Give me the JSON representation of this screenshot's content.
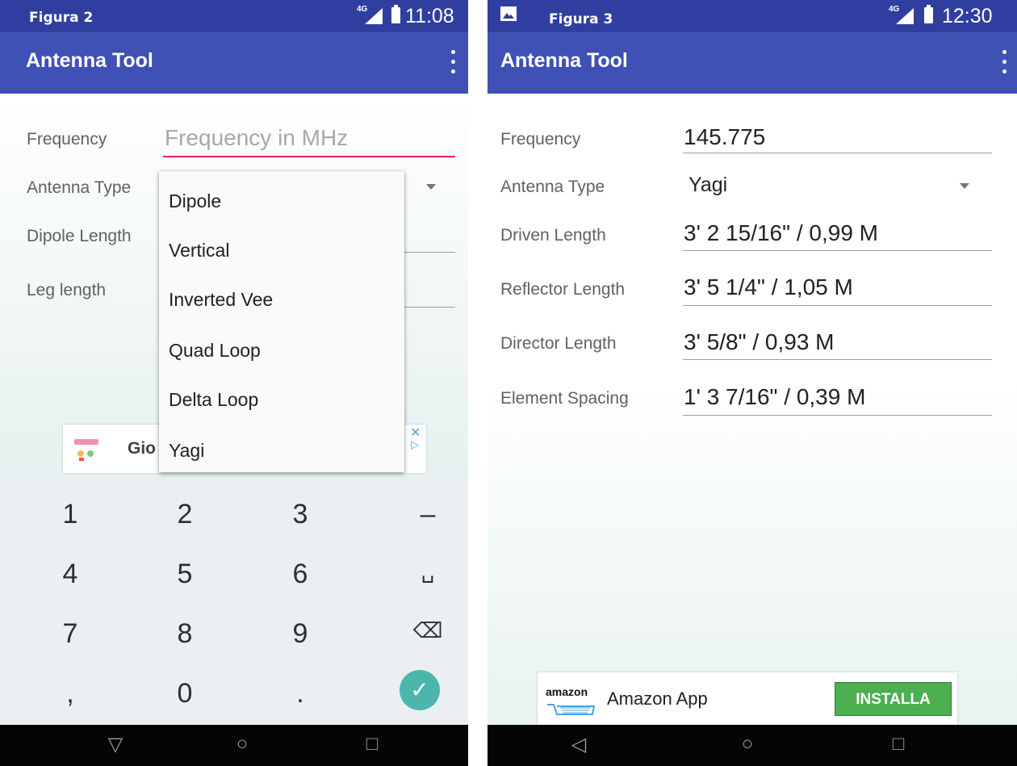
{
  "colors": {
    "primary": "#3f51b5",
    "status": "#303f9f",
    "accent": "#e91e63",
    "check": "#4db6ac",
    "install": "#4caf50"
  },
  "left": {
    "figure_label": "Figura 2",
    "clock": "11:08",
    "signal_label": "4G",
    "app_title": "Antenna Tool",
    "form": {
      "frequency_label": "Frequency",
      "frequency_placeholder": "Frequency in MHz",
      "antenna_type_label": "Antenna Type",
      "dipole_length_label": "Dipole Length",
      "leg_length_label": "Leg length"
    },
    "dropdown_options": [
      "Dipole",
      "Vertical",
      "Inverted Vee",
      "Quad Loop",
      "Delta Loop",
      "Yagi"
    ],
    "ad_text": "Gio",
    "keyboard": {
      "row1": [
        "1",
        "2",
        "3",
        "–"
      ],
      "row2": [
        "4",
        "5",
        "6",
        "␣"
      ],
      "row3": [
        "7",
        "8",
        "9",
        "⌫"
      ],
      "row4": [
        ",",
        "0",
        ".",
        "✓"
      ]
    }
  },
  "right": {
    "figure_label": "Figura 3",
    "clock": "12:30",
    "signal_label": "4G",
    "app_title": "Antenna Tool",
    "form": {
      "frequency_label": "Frequency",
      "frequency_value": "145.775",
      "antenna_type_label": "Antenna Type",
      "antenna_type_value": "Yagi",
      "driven_length_label": "Driven Length",
      "driven_length_value": "3' 2 15/16\" / 0,99 M",
      "reflector_length_label": "Reflector Length",
      "reflector_length_value": "3' 5 1/4\" / 1,05 M",
      "director_length_label": "Director Length",
      "director_length_value": "3' 5/8\" / 0,93 M",
      "element_spacing_label": "Element Spacing",
      "element_spacing_value": "1' 3 7/16\" / 0,39 M"
    },
    "ad": {
      "logo_text": "amazon",
      "name": "Amazon App",
      "button": "INSTALLA"
    }
  }
}
